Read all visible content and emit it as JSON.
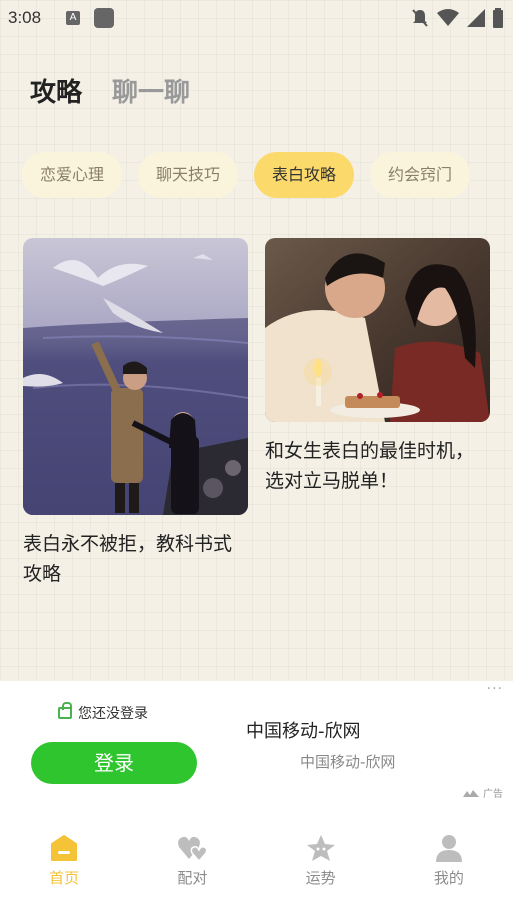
{
  "status_bar": {
    "time": "3:08",
    "a_badge": "A"
  },
  "top_tabs": [
    {
      "label": "攻略",
      "active": true
    },
    {
      "label": "聊一聊",
      "active": false
    }
  ],
  "categories": [
    {
      "label": "恋爱心理",
      "active": false
    },
    {
      "label": "聊天技巧",
      "active": false
    },
    {
      "label": "表白攻略",
      "active": true
    },
    {
      "label": "约会窍门",
      "active": false
    }
  ],
  "articles": [
    {
      "title": "表白永不被拒，教科书式攻略"
    },
    {
      "title": "和女生表白的最佳时机，选对立马脱单！"
    }
  ],
  "ad": {
    "more": "···",
    "login_note": "您还没登录",
    "login_button": "登录",
    "title": "中国移动-欣网",
    "subtitle": "中国移动-欣网",
    "tag": "广告"
  },
  "bottom_nav": [
    {
      "label": "首页",
      "icon": "home-icon",
      "active": true
    },
    {
      "label": "配对",
      "icon": "hearts-icon",
      "active": false
    },
    {
      "label": "运势",
      "icon": "star-icon",
      "active": false
    },
    {
      "label": "我的",
      "icon": "person-icon",
      "active": false
    }
  ],
  "colors": {
    "accent": "#fbd96a",
    "nav_active": "#f5c338",
    "login_green": "#2fc52f"
  }
}
